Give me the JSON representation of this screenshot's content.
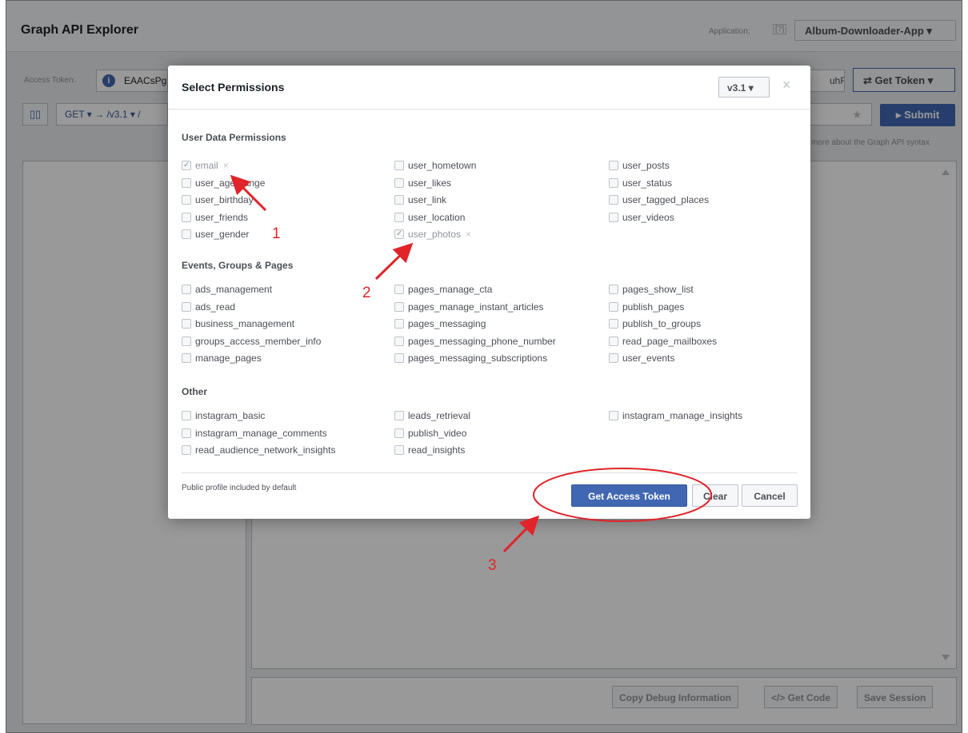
{
  "app": {
    "title": "Graph API Explorer",
    "application_label": "Application:",
    "help_icon_text": "[?]",
    "application_name": "Album-Downloader-App ▾"
  },
  "token": {
    "label": "Access Token:",
    "info_icon_text": "i",
    "value_start": "EAACsPg",
    "value_end": "uhRc",
    "get_token_label": "⇄ Get Token ▾"
  },
  "request": {
    "book_icon_text": "▯▯",
    "method_path": "GET ▾ → /v3.1 ▾ /",
    "star_icon_text": "★",
    "submit_label": "▸ Submit",
    "syntax_hint": "more about the Graph API syntax"
  },
  "bottom_bar": {
    "copy_debug": "Copy Debug Information",
    "get_code": "</> Get Code",
    "save_session": "Save Session"
  },
  "modal": {
    "title": "Select Permissions",
    "version": "v3.1 ▾",
    "close": "×",
    "sections": {
      "user_data": "User Data Permissions",
      "events": "Events, Groups & Pages",
      "other": "Other"
    },
    "user_data_permissions": [
      {
        "label": "email",
        "checked": true
      },
      {
        "label": "user_age_range",
        "checked": false
      },
      {
        "label": "user_birthday",
        "checked": false
      },
      {
        "label": "user_friends",
        "checked": false
      },
      {
        "label": "user_gender",
        "checked": false
      },
      {
        "label": "user_hometown",
        "checked": false
      },
      {
        "label": "user_likes",
        "checked": false
      },
      {
        "label": "user_link",
        "checked": false
      },
      {
        "label": "user_location",
        "checked": false
      },
      {
        "label": "user_photos",
        "checked": true
      },
      {
        "label": "user_posts",
        "checked": false
      },
      {
        "label": "user_status",
        "checked": false
      },
      {
        "label": "user_tagged_places",
        "checked": false
      },
      {
        "label": "user_videos",
        "checked": false
      }
    ],
    "events_permissions": [
      {
        "label": "ads_management",
        "checked": false
      },
      {
        "label": "ads_read",
        "checked": false
      },
      {
        "label": "business_management",
        "checked": false
      },
      {
        "label": "groups_access_member_info",
        "checked": false
      },
      {
        "label": "manage_pages",
        "checked": false
      },
      {
        "label": "pages_manage_cta",
        "checked": false
      },
      {
        "label": "pages_manage_instant_articles",
        "checked": false
      },
      {
        "label": "pages_messaging",
        "checked": false
      },
      {
        "label": "pages_messaging_phone_number",
        "checked": false
      },
      {
        "label": "pages_messaging_subscriptions",
        "checked": false
      },
      {
        "label": "pages_show_list",
        "checked": false
      },
      {
        "label": "publish_pages",
        "checked": false
      },
      {
        "label": "publish_to_groups",
        "checked": false
      },
      {
        "label": "read_page_mailboxes",
        "checked": false
      },
      {
        "label": "user_events",
        "checked": false
      }
    ],
    "other_permissions": [
      {
        "label": "instagram_basic",
        "checked": false
      },
      {
        "label": "instagram_manage_comments",
        "checked": false
      },
      {
        "label": "read_audience_network_insights",
        "checked": false
      },
      {
        "label": "leads_retrieval",
        "checked": false
      },
      {
        "label": "publish_video",
        "checked": false
      },
      {
        "label": "read_insights",
        "checked": false
      },
      {
        "label": "instagram_manage_insights",
        "checked": false
      }
    ],
    "footer_note": "Public profile included by default",
    "get_access_token": "Get Access Token",
    "clear": "Clear",
    "cancel": "Cancel"
  },
  "annotations": {
    "step1": "1",
    "step2": "2",
    "step3": "3",
    "color": "#e0242a"
  }
}
